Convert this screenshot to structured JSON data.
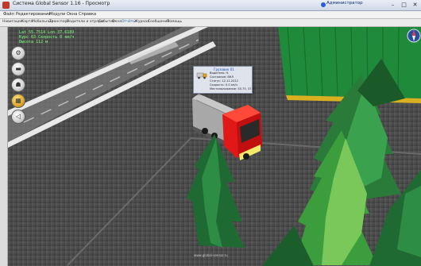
{
  "window": {
    "title": "Система Global Sensor 1.16 - Просмотр",
    "user": "Администратор",
    "controls": {
      "minimize": "–",
      "maximize": "□",
      "close": "✕"
    }
  },
  "menu": [
    "Файл",
    "Редактирование",
    "Модули",
    "Окна",
    "Справка"
  ],
  "toolbar": {
    "items": [
      "Навигация",
      "Карта",
      "Мобильные",
      "Транспорт",
      "Водители и отряды",
      "События",
      "Окна",
      "Отчёты",
      "Журнал",
      "Сообщения",
      "Помощь"
    ],
    "active_index": 7
  },
  "map_status": {
    "line1": "Lat 55.7514  Lon 37.6189",
    "line2": "Курс 63   Скорость 0 км/ч",
    "line3": "Высота 112 м"
  },
  "map_tools": [
    {
      "icon": "gear-icon",
      "glyph": "⚙",
      "active": false
    },
    {
      "icon": "truck-icon",
      "glyph": "▬",
      "active": false
    },
    {
      "icon": "people-icon",
      "glyph": "☗",
      "active": false
    },
    {
      "icon": "warehouse-icon",
      "glyph": "▦",
      "active": true
    },
    {
      "icon": "speaker-icon",
      "glyph": "◁",
      "active": false
    }
  ],
  "vehicle_popup": {
    "title": "Грузовик 01",
    "lines": [
      "Водитель: Н.",
      "Состояние: ВКЛ",
      "Статус: 12.11.2012",
      "Скорость: 0.0 км/ч",
      "Местоположение: 55.75, 37.61"
    ]
  },
  "colors": {
    "truck_cab": "#e01818",
    "warehouse_roof": "#1f8a3a",
    "road_line": "#e8e8e8",
    "status_text": "#7dff7d"
  },
  "watermark": "www.global-sensor.ru"
}
